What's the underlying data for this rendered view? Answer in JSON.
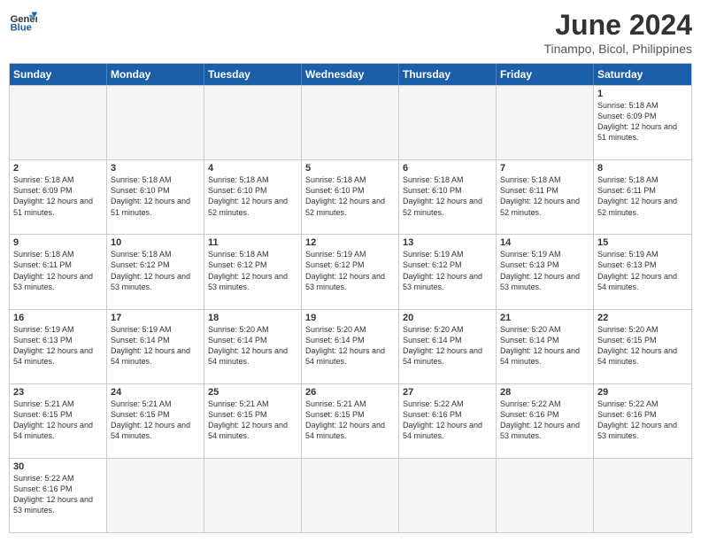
{
  "header": {
    "logo_general": "General",
    "logo_blue": "Blue",
    "month_title": "June 2024",
    "subtitle": "Tinampo, Bicol, Philippines"
  },
  "weekdays": [
    "Sunday",
    "Monday",
    "Tuesday",
    "Wednesday",
    "Thursday",
    "Friday",
    "Saturday"
  ],
  "rows": [
    [
      {
        "day": "",
        "info": ""
      },
      {
        "day": "",
        "info": ""
      },
      {
        "day": "",
        "info": ""
      },
      {
        "day": "",
        "info": ""
      },
      {
        "day": "",
        "info": ""
      },
      {
        "day": "",
        "info": ""
      },
      {
        "day": "1",
        "info": "Sunrise: 5:18 AM\nSunset: 6:09 PM\nDaylight: 12 hours and 51 minutes."
      }
    ],
    [
      {
        "day": "2",
        "info": "Sunrise: 5:18 AM\nSunset: 6:09 PM\nDaylight: 12 hours and 51 minutes."
      },
      {
        "day": "3",
        "info": "Sunrise: 5:18 AM\nSunset: 6:10 PM\nDaylight: 12 hours and 51 minutes."
      },
      {
        "day": "4",
        "info": "Sunrise: 5:18 AM\nSunset: 6:10 PM\nDaylight: 12 hours and 52 minutes."
      },
      {
        "day": "5",
        "info": "Sunrise: 5:18 AM\nSunset: 6:10 PM\nDaylight: 12 hours and 52 minutes."
      },
      {
        "day": "6",
        "info": "Sunrise: 5:18 AM\nSunset: 6:10 PM\nDaylight: 12 hours and 52 minutes."
      },
      {
        "day": "7",
        "info": "Sunrise: 5:18 AM\nSunset: 6:11 PM\nDaylight: 12 hours and 52 minutes."
      },
      {
        "day": "8",
        "info": "Sunrise: 5:18 AM\nSunset: 6:11 PM\nDaylight: 12 hours and 52 minutes."
      }
    ],
    [
      {
        "day": "9",
        "info": "Sunrise: 5:18 AM\nSunset: 6:11 PM\nDaylight: 12 hours and 53 minutes."
      },
      {
        "day": "10",
        "info": "Sunrise: 5:18 AM\nSunset: 6:12 PM\nDaylight: 12 hours and 53 minutes."
      },
      {
        "day": "11",
        "info": "Sunrise: 5:18 AM\nSunset: 6:12 PM\nDaylight: 12 hours and 53 minutes."
      },
      {
        "day": "12",
        "info": "Sunrise: 5:19 AM\nSunset: 6:12 PM\nDaylight: 12 hours and 53 minutes."
      },
      {
        "day": "13",
        "info": "Sunrise: 5:19 AM\nSunset: 6:12 PM\nDaylight: 12 hours and 53 minutes."
      },
      {
        "day": "14",
        "info": "Sunrise: 5:19 AM\nSunset: 6:13 PM\nDaylight: 12 hours and 53 minutes."
      },
      {
        "day": "15",
        "info": "Sunrise: 5:19 AM\nSunset: 6:13 PM\nDaylight: 12 hours and 54 minutes."
      }
    ],
    [
      {
        "day": "16",
        "info": "Sunrise: 5:19 AM\nSunset: 6:13 PM\nDaylight: 12 hours and 54 minutes."
      },
      {
        "day": "17",
        "info": "Sunrise: 5:19 AM\nSunset: 6:14 PM\nDaylight: 12 hours and 54 minutes."
      },
      {
        "day": "18",
        "info": "Sunrise: 5:20 AM\nSunset: 6:14 PM\nDaylight: 12 hours and 54 minutes."
      },
      {
        "day": "19",
        "info": "Sunrise: 5:20 AM\nSunset: 6:14 PM\nDaylight: 12 hours and 54 minutes."
      },
      {
        "day": "20",
        "info": "Sunrise: 5:20 AM\nSunset: 6:14 PM\nDaylight: 12 hours and 54 minutes."
      },
      {
        "day": "21",
        "info": "Sunrise: 5:20 AM\nSunset: 6:14 PM\nDaylight: 12 hours and 54 minutes."
      },
      {
        "day": "22",
        "info": "Sunrise: 5:20 AM\nSunset: 6:15 PM\nDaylight: 12 hours and 54 minutes."
      }
    ],
    [
      {
        "day": "23",
        "info": "Sunrise: 5:21 AM\nSunset: 6:15 PM\nDaylight: 12 hours and 54 minutes."
      },
      {
        "day": "24",
        "info": "Sunrise: 5:21 AM\nSunset: 6:15 PM\nDaylight: 12 hours and 54 minutes."
      },
      {
        "day": "25",
        "info": "Sunrise: 5:21 AM\nSunset: 6:15 PM\nDaylight: 12 hours and 54 minutes."
      },
      {
        "day": "26",
        "info": "Sunrise: 5:21 AM\nSunset: 6:15 PM\nDaylight: 12 hours and 54 minutes."
      },
      {
        "day": "27",
        "info": "Sunrise: 5:22 AM\nSunset: 6:16 PM\nDaylight: 12 hours and 54 minutes."
      },
      {
        "day": "28",
        "info": "Sunrise: 5:22 AM\nSunset: 6:16 PM\nDaylight: 12 hours and 53 minutes."
      },
      {
        "day": "29",
        "info": "Sunrise: 5:22 AM\nSunset: 6:16 PM\nDaylight: 12 hours and 53 minutes."
      }
    ],
    [
      {
        "day": "30",
        "info": "Sunrise: 5:22 AM\nSunset: 6:16 PM\nDaylight: 12 hours and 53 minutes."
      },
      {
        "day": "",
        "info": ""
      },
      {
        "day": "",
        "info": ""
      },
      {
        "day": "",
        "info": ""
      },
      {
        "day": "",
        "info": ""
      },
      {
        "day": "",
        "info": ""
      },
      {
        "day": "",
        "info": ""
      }
    ]
  ]
}
